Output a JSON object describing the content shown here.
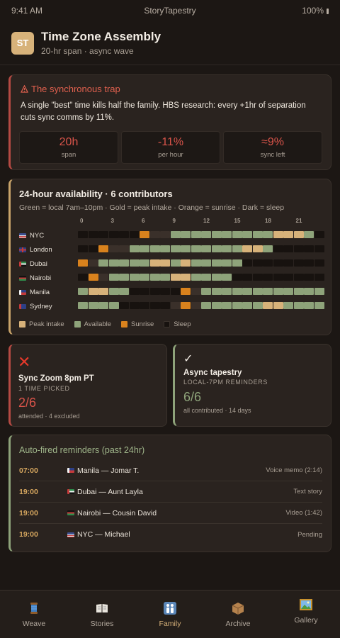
{
  "status_bar": {
    "time": "9:41 AM",
    "app": "StoryTapestry",
    "battery": "100%"
  },
  "header": {
    "logo": "ST",
    "title": "Time Zone Assembly",
    "subtitle": "20-hr span · async wave"
  },
  "trap": {
    "icon": "warning-icon",
    "title": "The synchronous trap",
    "body": "A single \"best\" time kills half the family. HBS research: every +1hr of separation cuts sync comms by 11%.",
    "stats": [
      {
        "value": "20h",
        "label": "span"
      },
      {
        "value": "-11%",
        "label": "per hour"
      },
      {
        "value": "≈9%",
        "label": "sync left"
      }
    ]
  },
  "availability": {
    "title": "24-hour availability · 6 contributors",
    "description": "Green = local 7am–10pm · Gold = peak intake · Orange = sunrise · Dark = sleep",
    "hour_labels": [
      "0",
      "3",
      "6",
      "9",
      "12",
      "15",
      "18",
      "21"
    ],
    "colors": {
      "P": "#d7b27a",
      "A": "#8ea37a",
      "S": "#d9821d",
      "D": "#17120f",
      "T": "#3a302a"
    },
    "rows": [
      {
        "city": "NYC",
        "flag": "us",
        "cells": "DDDDDDSTTAAAAAAAAAAPPPAD"
      },
      {
        "city": "London",
        "flag": "gb",
        "cells": "DDSTTAAAAAAAAAAAPPADDDDD"
      },
      {
        "city": "Dubai",
        "flag": "ae",
        "cells": "STAAAAAPPAPAAAAADDDDDDDD"
      },
      {
        "city": "Nairobi",
        "flag": "ke",
        "cells": "DSTAAAAAAPPAAAADDDDDDDDD"
      },
      {
        "city": "Manila",
        "flag": "ph",
        "cells": "APPAADDDDDSTAAAAAAAAAAAA"
      },
      {
        "city": "Sydney",
        "flag": "au",
        "cells": "AAAADDDDDTSTAAAAAAPPAAAA"
      }
    ],
    "legend": [
      {
        "label": "Peak intake",
        "color": "#d7b27a"
      },
      {
        "label": "Available",
        "color": "#8ea37a"
      },
      {
        "label": "Sunrise",
        "color": "#d9821d"
      },
      {
        "label": "Sleep",
        "color": "#17120f"
      }
    ]
  },
  "sync": {
    "icon": "x-icon",
    "title": "Sync Zoom 8pm PT",
    "subtitle": "1 TIME PICKED",
    "value": "2/6",
    "note": "attended · 4 excluded"
  },
  "async": {
    "icon": "check-icon",
    "title": "Async tapestry",
    "subtitle": "LOCAL-7PM REMINDERS",
    "value": "6/6",
    "note": "all contributed · 14 days"
  },
  "reminders": {
    "title": "Auto-fired reminders (past 24hr)",
    "items": [
      {
        "time": "07:00",
        "flag": "ph",
        "name": "Manila — Jomar T.",
        "status": "Voice memo (2:14)"
      },
      {
        "time": "19:00",
        "flag": "ae",
        "name": "Dubai — Aunt Layla",
        "status": "Text story"
      },
      {
        "time": "19:00",
        "flag": "ke",
        "name": "Nairobi — Cousin David",
        "status": "Video (1:42)"
      },
      {
        "time": "19:00",
        "flag": "us",
        "name": "NYC — Michael",
        "status": "Pending"
      }
    ]
  },
  "nav": [
    {
      "label": "Weave",
      "icon": "spool-icon",
      "active": false
    },
    {
      "label": "Stories",
      "icon": "book-icon",
      "active": false
    },
    {
      "label": "Family",
      "icon": "family-icon",
      "active": true
    },
    {
      "label": "Archive",
      "icon": "box-icon",
      "active": false
    },
    {
      "label": "Gallery",
      "icon": "picture-icon",
      "active": false
    }
  ]
}
